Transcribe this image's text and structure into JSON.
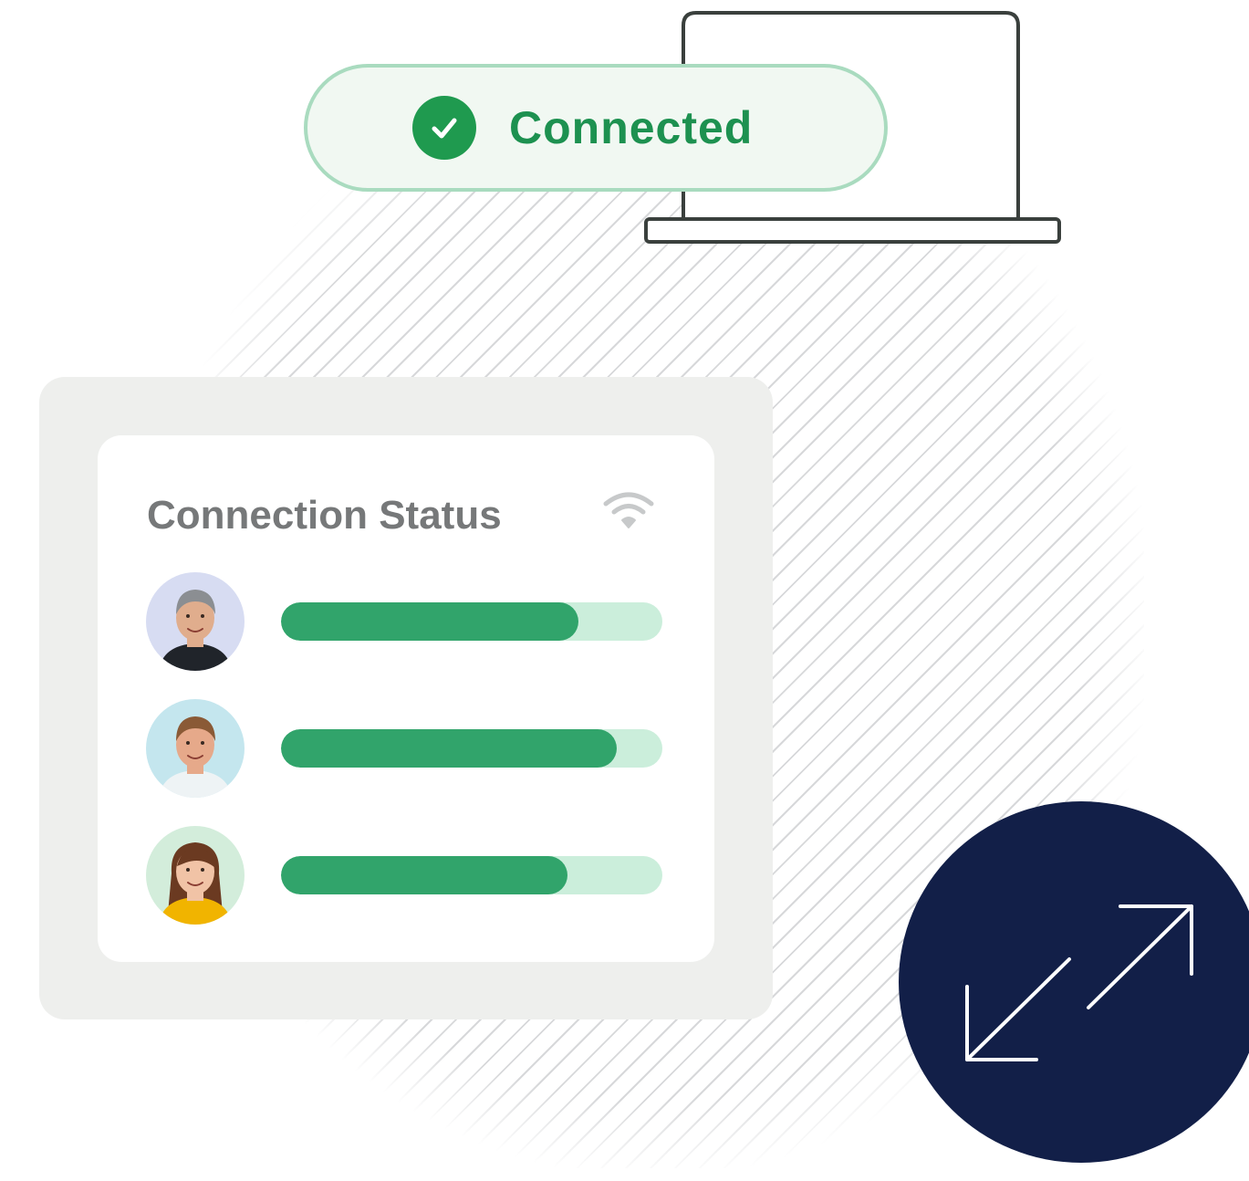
{
  "status_pill": {
    "label": "Connected",
    "icon": "check-circle-icon",
    "color": "#1d9150"
  },
  "laptop": {
    "icon": "laptop-icon"
  },
  "connection_panel": {
    "title": "Connection Status",
    "wifi_icon": "wifi-icon",
    "users": [
      {
        "avatar": "avatar-gray-haired-man",
        "avatar_bg": "#d7dcf2",
        "skin": "#e0ad8d",
        "hair": "#8b8e92",
        "shirt": "#20242a",
        "level": 0.78
      },
      {
        "avatar": "avatar-smiling-man",
        "avatar_bg": "#c4e6ee",
        "skin": "#e6a98a",
        "hair": "#8a5a36",
        "shirt": "#eef3f5",
        "level": 0.88
      },
      {
        "avatar": "avatar-smiling-woman",
        "avatar_bg": "#d3eddb",
        "skin": "#f1c3a6",
        "hair": "#6b3a21",
        "shirt": "#f1b400",
        "level": 0.75
      }
    ],
    "bar_fill_color": "#31a46b",
    "bar_track_color": "#cbeedb"
  },
  "swap_button": {
    "icon": "swap-arrows-icon",
    "bg": "#121f48"
  }
}
